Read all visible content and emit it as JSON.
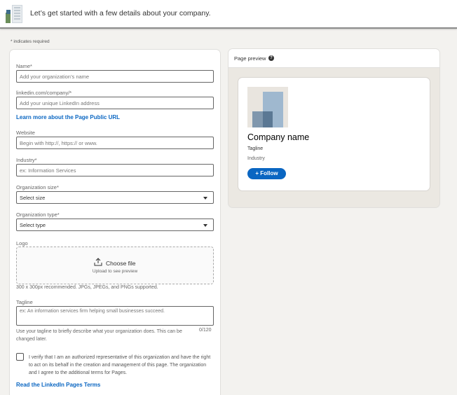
{
  "header": {
    "title": "Let’s get started with a few details about your company."
  },
  "form": {
    "required_note": "* indicates required",
    "name": {
      "label": "Name*",
      "placeholder": "Add your organization’s name"
    },
    "url": {
      "label": "linkedin.com/company/*",
      "placeholder": "Add your unique LinkedIn address"
    },
    "learn_more_link": "Learn more about the Page Public URL",
    "website": {
      "label": "Website",
      "placeholder": "Begin with http://, https:// or www."
    },
    "industry": {
      "label": "Industry*",
      "placeholder": "ex: Information Services"
    },
    "org_size": {
      "label": "Organization size*",
      "selected": "Select size"
    },
    "org_type": {
      "label": "Organization type*",
      "selected": "Select type"
    },
    "logo": {
      "label": "Logo",
      "choose_file": "Choose file",
      "upload_hint": "Upload to see preview",
      "recommendation": "300 x 300px recommended. JPGs, JPEGs, and PNGs supported."
    },
    "tagline": {
      "label": "Tagline",
      "placeholder": "ex: An information services firm helping small businesses succeed.",
      "help": "Use your tagline to briefly describe what your organization does. This can be changed later.",
      "counter": "0/120"
    },
    "verify_text": "I verify that I am an authorized representative of this organization and have the right to act on its behalf in the creation and management of this page. The organization and I agree to the additional terms for Pages.",
    "terms_link": "Read the LinkedIn Pages Terms"
  },
  "preview": {
    "title": "Page preview",
    "help_glyph": "?",
    "company_name": "Company name",
    "tagline": "Tagline",
    "industry": "Industry",
    "follow_button": "+ Follow"
  },
  "colors": {
    "accent": "#0a66c2",
    "logo_light": "#9fb8cf",
    "logo_dark": "#6d8aa5",
    "preview_bg": "#ebe8e2"
  }
}
